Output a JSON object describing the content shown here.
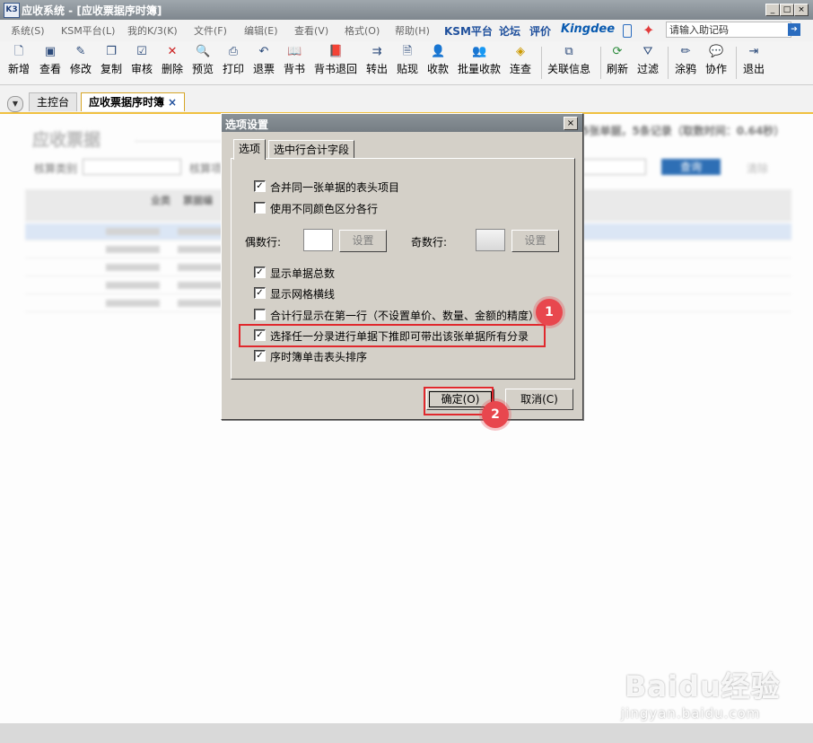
{
  "window": {
    "app_icon": "K3",
    "title": "应收系统 - [应收票据序时簿]",
    "controls": [
      "_",
      "□",
      "×"
    ]
  },
  "menu": {
    "items": [
      "系统(S)",
      "KSM平台(L)",
      "我的K/3(K)",
      "文件(F)",
      "编辑(E)",
      "查看(V)",
      "格式(O)",
      "帮助(H)"
    ],
    "links": [
      "KSM平台",
      "论坛",
      "评价"
    ],
    "brand": "Kingdee",
    "help_placeholder": "请输入助记码"
  },
  "toolbar": [
    {
      "label": "新增",
      "icon": "new-icon"
    },
    {
      "label": "查看",
      "icon": "view-icon"
    },
    {
      "label": "修改",
      "icon": "edit-icon"
    },
    {
      "label": "复制",
      "icon": "copy-icon"
    },
    {
      "label": "审核",
      "icon": "audit-icon"
    },
    {
      "label": "删除",
      "icon": "delete-icon"
    },
    {
      "label": "预览",
      "icon": "preview-icon"
    },
    {
      "label": "打印",
      "icon": "print-icon"
    },
    {
      "label": "退票",
      "icon": "return-icon"
    },
    {
      "label": "背书",
      "icon": "endorse-icon"
    },
    {
      "label": "背书退回",
      "icon": "endorse-return-icon"
    },
    {
      "label": "转出",
      "icon": "transfer-icon"
    },
    {
      "label": "贴现",
      "icon": "discount-icon"
    },
    {
      "label": "收款",
      "icon": "receive-icon"
    },
    {
      "label": "批量收款",
      "icon": "batch-receive-icon"
    },
    {
      "label": "连查",
      "icon": "link-query-icon"
    },
    {
      "label": "关联信息",
      "icon": "related-info-icon"
    },
    {
      "label": "刷新",
      "icon": "refresh-icon"
    },
    {
      "label": "过滤",
      "icon": "filter-icon"
    },
    {
      "label": "涂鸦",
      "icon": "doodle-icon"
    },
    {
      "label": "协作",
      "icon": "collab-icon"
    },
    {
      "label": "退出",
      "icon": "exit-icon"
    }
  ],
  "tabs": {
    "items": [
      {
        "label": "主控台"
      },
      {
        "label": "应收票据序时簿",
        "close": "×"
      }
    ]
  },
  "page": {
    "title": "应收票据",
    "record_info": "5张单据，5条记录（取数时间：0.64秒）",
    "filter_labels": [
      "核算类别",
      "核算项"
    ],
    "query_button": "查询",
    "clear_button": "清除",
    "columns": [
      "业类",
      "票据编"
    ]
  },
  "dialog": {
    "title": "选项设置",
    "close": "×",
    "tabs": [
      "选项",
      "选中行合计字段"
    ],
    "options_top": [
      {
        "label": "合并同一张单据的表头项目",
        "checked": true
      },
      {
        "label": "使用不同颜色区分各行",
        "checked": false
      }
    ],
    "even_row_label": "偶数行:",
    "odd_row_label": "奇数行:",
    "set_button": "设置",
    "options_bottom": [
      {
        "label": "显示单据总数",
        "checked": true
      },
      {
        "label": "显示网格横线",
        "checked": true
      },
      {
        "label": "合计行显示在第一行（不设置单价、数量、金额的精度）",
        "checked": false
      },
      {
        "label": "选择任一分录进行单据下推即可带出该张单据所有分录",
        "checked": true
      },
      {
        "label": "序时簿单击表头排序",
        "checked": true
      }
    ],
    "ok_button": "确定(O)",
    "cancel_button": "取消(C)",
    "check_mark": "✓",
    "colors": {
      "highlight": "#e0282d",
      "badge": "#e8474e"
    }
  },
  "annotations": [
    "1",
    "2"
  ],
  "watermark": {
    "text": "Baidu经验",
    "url": "jingyan.baidu.com"
  }
}
